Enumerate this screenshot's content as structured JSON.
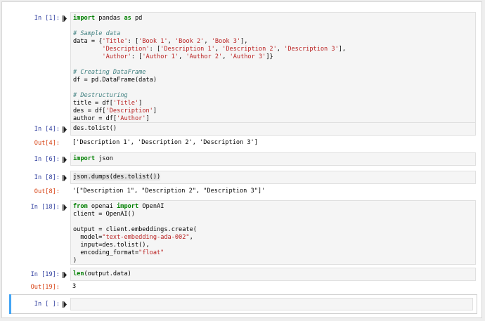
{
  "cells": [
    {
      "in_prompt": "In [1]:",
      "code_lines": [
        [
          [
            "kw",
            "import"
          ],
          [
            "nm",
            " pandas "
          ],
          [
            "kw",
            "as"
          ],
          [
            "nm",
            " pd"
          ]
        ],
        [],
        [
          [
            "cm",
            "# Sample data"
          ]
        ],
        [
          [
            "nm",
            "data = {"
          ],
          [
            "str",
            "'Title'"
          ],
          [
            "nm",
            ": ["
          ],
          [
            "str",
            "'Book 1'"
          ],
          [
            "nm",
            ", "
          ],
          [
            "str",
            "'Book 2'"
          ],
          [
            "nm",
            ", "
          ],
          [
            "str",
            "'Book 3'"
          ],
          [
            "nm",
            "],"
          ]
        ],
        [
          [
            "nm",
            "        "
          ],
          [
            "str",
            "'Description'"
          ],
          [
            "nm",
            ": ["
          ],
          [
            "str",
            "'Description 1'"
          ],
          [
            "nm",
            ", "
          ],
          [
            "str",
            "'Description 2'"
          ],
          [
            "nm",
            ", "
          ],
          [
            "str",
            "'Description 3'"
          ],
          [
            "nm",
            "],"
          ]
        ],
        [
          [
            "nm",
            "        "
          ],
          [
            "str",
            "'Author'"
          ],
          [
            "nm",
            ": ["
          ],
          [
            "str",
            "'Author 1'"
          ],
          [
            "nm",
            ", "
          ],
          [
            "str",
            "'Author 2'"
          ],
          [
            "nm",
            ", "
          ],
          [
            "str",
            "'Author 3'"
          ],
          [
            "nm",
            "]}"
          ]
        ],
        [],
        [
          [
            "cm",
            "# Creating DataFrame"
          ]
        ],
        [
          [
            "nm",
            "df = pd.DataFrame(data)"
          ]
        ],
        [],
        [
          [
            "cm",
            "# Destructuring"
          ]
        ],
        [
          [
            "nm",
            "title = df["
          ],
          [
            "str",
            "'Title'"
          ],
          [
            "nm",
            "]"
          ]
        ],
        [
          [
            "nm",
            "des = df["
          ],
          [
            "str",
            "'Description'"
          ],
          [
            "nm",
            "]"
          ]
        ],
        [
          [
            "nm",
            "author = df["
          ],
          [
            "str",
            "'Author'"
          ],
          [
            "nm",
            "]"
          ]
        ]
      ]
    },
    {
      "in_prompt": "In [4]:",
      "code_lines": [
        [
          [
            "nm",
            "des.tolist()"
          ]
        ]
      ],
      "out_prompt": "Out[4]:",
      "output": "['Description 1', 'Description 2', 'Description 3']"
    },
    {
      "in_prompt": "In [6]:",
      "code_lines": [
        [
          [
            "kw",
            "import"
          ],
          [
            "nm",
            " json"
          ]
        ]
      ]
    },
    {
      "in_prompt": "In [8]:",
      "code_lines": [
        [
          [
            "nm",
            "json.dumps(des.tolist())"
          ]
        ]
      ],
      "out_prompt": "Out[8]:",
      "output": "'[\"Description 1\", \"Description 2\", \"Description 3\"]'"
    },
    {
      "in_prompt": "In [18]:",
      "code_lines": [
        [
          [
            "kw",
            "from"
          ],
          [
            "nm",
            " openai "
          ],
          [
            "kw",
            "import"
          ],
          [
            "nm",
            " OpenAI"
          ]
        ],
        [
          [
            "nm",
            "client = OpenAI()"
          ]
        ],
        [],
        [
          [
            "nm",
            "output = client.embeddings.create("
          ]
        ],
        [
          [
            "nm",
            "  model="
          ],
          [
            "str",
            "\"text-embedding-ada-002\""
          ],
          [
            "nm",
            ","
          ]
        ],
        [
          [
            "nm",
            "  input=des.tolist(),"
          ]
        ],
        [
          [
            "nm",
            "  encoding_format="
          ],
          [
            "str",
            "\"float\""
          ]
        ],
        [
          [
            "nm",
            ")"
          ]
        ]
      ]
    },
    {
      "in_prompt": "In [19]:",
      "code_lines": [
        [
          [
            "kw",
            "len"
          ],
          [
            "nm",
            "(output.data)"
          ]
        ]
      ],
      "out_prompt": "Out[19]:",
      "output": "3"
    },
    {
      "in_prompt": "In [ ]:",
      "code_lines": [
        []
      ]
    }
  ],
  "colors": {
    "keyword": "#008000",
    "string": "#ba2121",
    "comment": "#408080",
    "in_prompt": "#303f9f",
    "out_prompt": "#d84315",
    "selected_bar": "#42a5f5"
  },
  "icons": {
    "run": "run-cell-icon"
  }
}
